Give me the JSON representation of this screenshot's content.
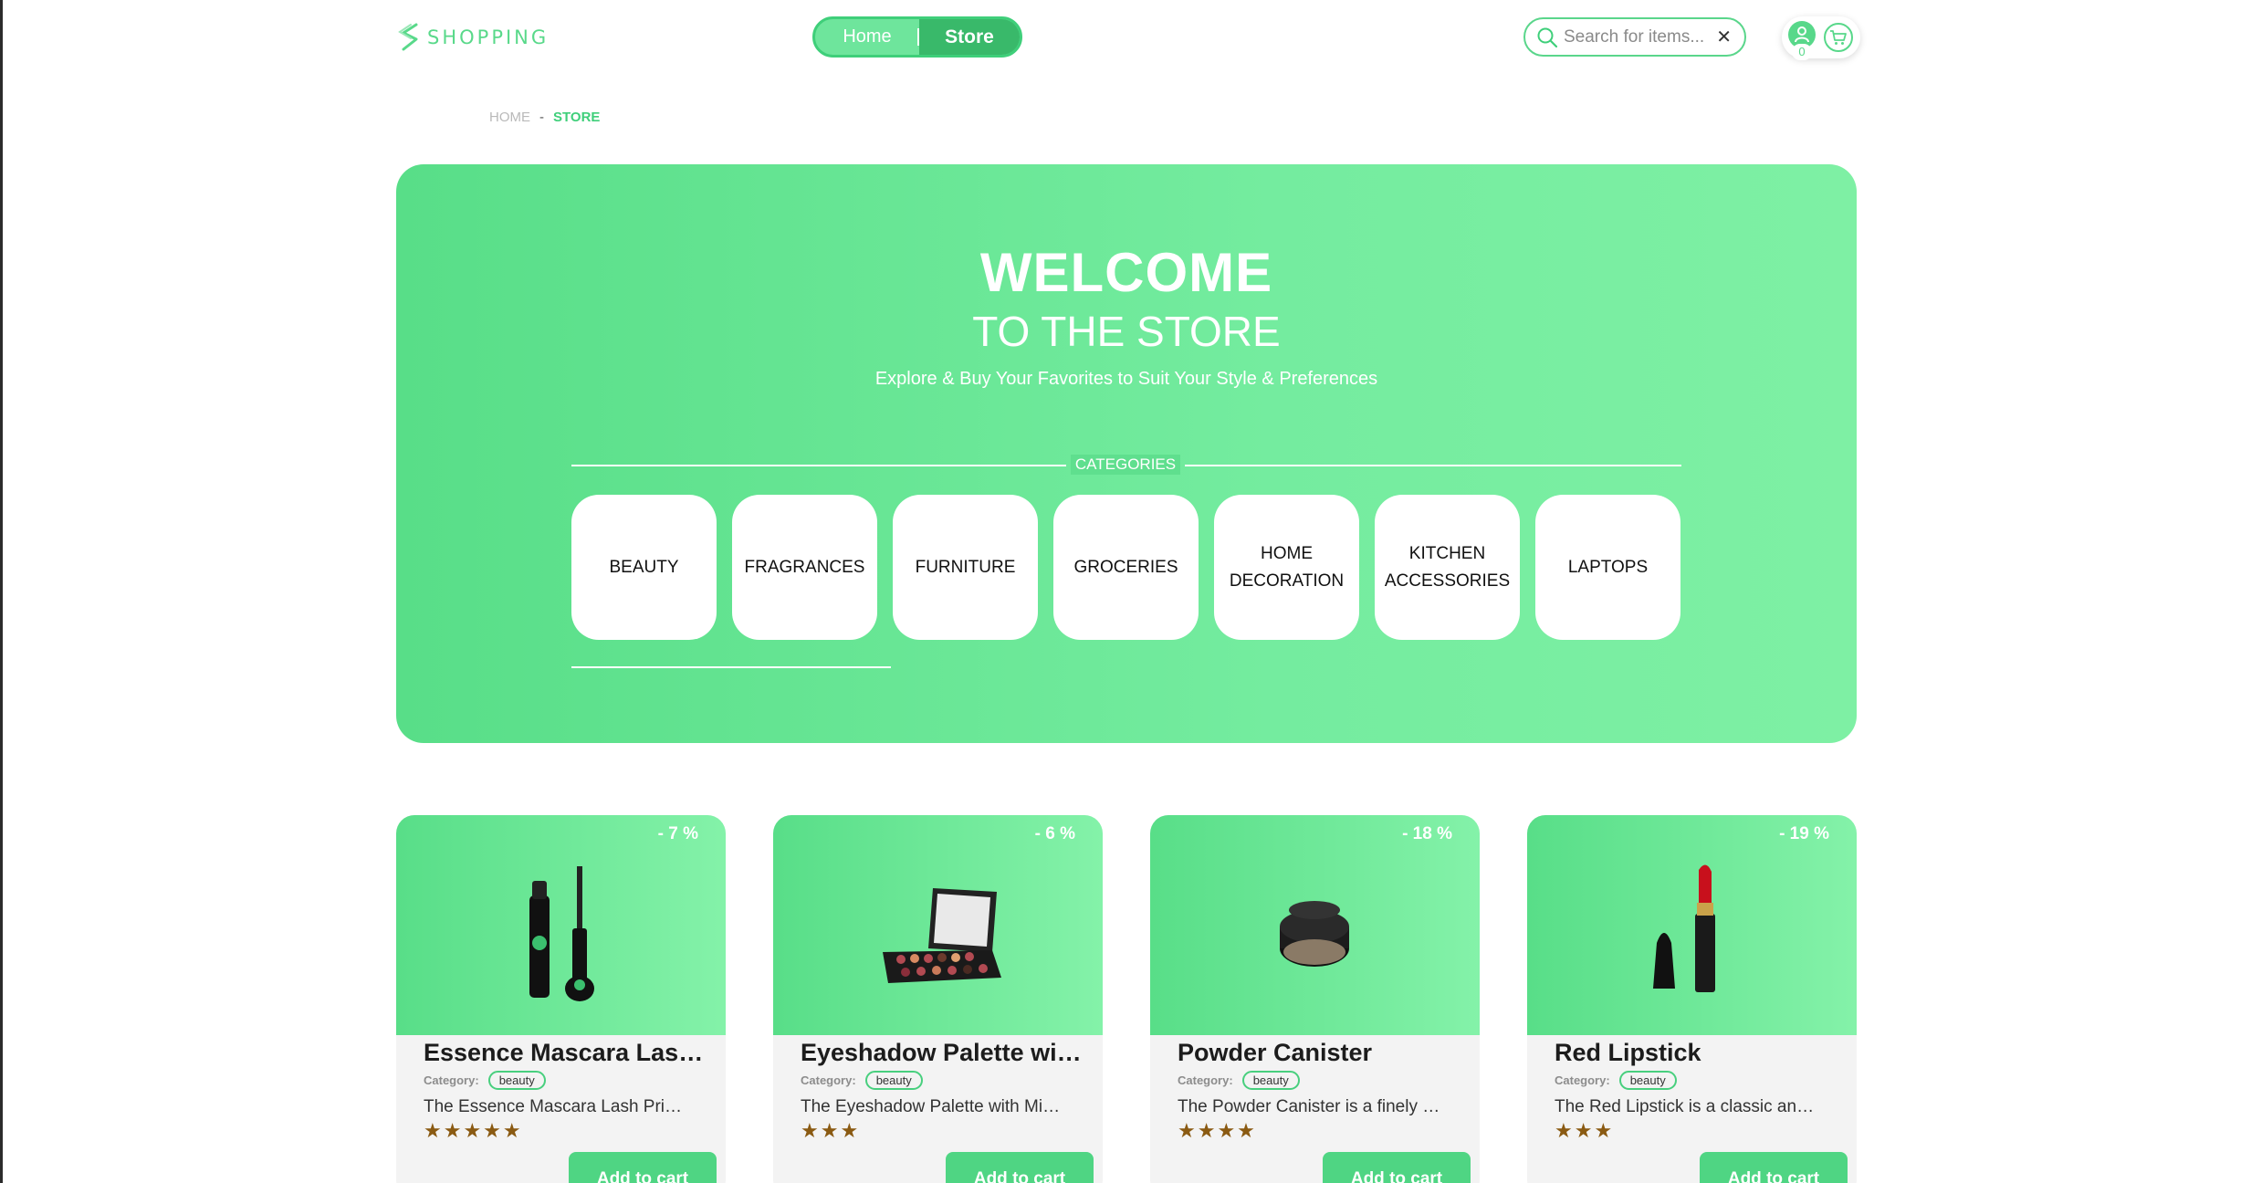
{
  "header": {
    "logo_text": "SHOPPING",
    "nav": {
      "home_label": "Home",
      "store_label": "Store"
    },
    "search": {
      "placeholder": "Search for items..."
    },
    "user_count": "0"
  },
  "breadcrumb": {
    "home": "HOME",
    "separator": "-",
    "current": "STORE"
  },
  "hero": {
    "title": "WELCOME",
    "subtitle": "TO THE STORE",
    "description": "Explore & Buy Your Favorites to Suit Your Style & Preferences",
    "categories_label": "CATEGORIES",
    "categories": [
      "BEAUTY",
      "FRAGRANCES",
      "FURNITURE",
      "GROCERIES",
      "HOME DECORATION",
      "KITCHEN ACCESSORIES",
      "LAPTOPS"
    ]
  },
  "products": [
    {
      "title": "Essence Mascara Lash Princess",
      "discount": "- 7 %",
      "category_label": "Category:",
      "category": "beauty",
      "description": "The Essence Mascara Lash Princess is a popular mascara",
      "stars": "★★★★★",
      "button": "Add to cart"
    },
    {
      "title": "Eyeshadow Palette with Mirror",
      "discount": "- 6 %",
      "category_label": "Category:",
      "category": "beauty",
      "description": "The Eyeshadow Palette with Mirror offers a versatile range",
      "stars": "★★★",
      "button": "Add to cart"
    },
    {
      "title": "Powder Canister",
      "discount": "- 18 %",
      "category_label": "Category:",
      "category": "beauty",
      "description": "The Powder Canister is a finely milled setting powder",
      "stars": "★★★★",
      "button": "Add to cart"
    },
    {
      "title": "Red Lipstick",
      "discount": "- 19 %",
      "category_label": "Category:",
      "category": "beauty",
      "description": "The Red Lipstick is a classic and bold choice",
      "stars": "★★★",
      "button": "Add to cart"
    }
  ],
  "colors": {
    "accent": "#58de88",
    "accent_dark": "#39b96a",
    "star": "#8a5a12"
  }
}
